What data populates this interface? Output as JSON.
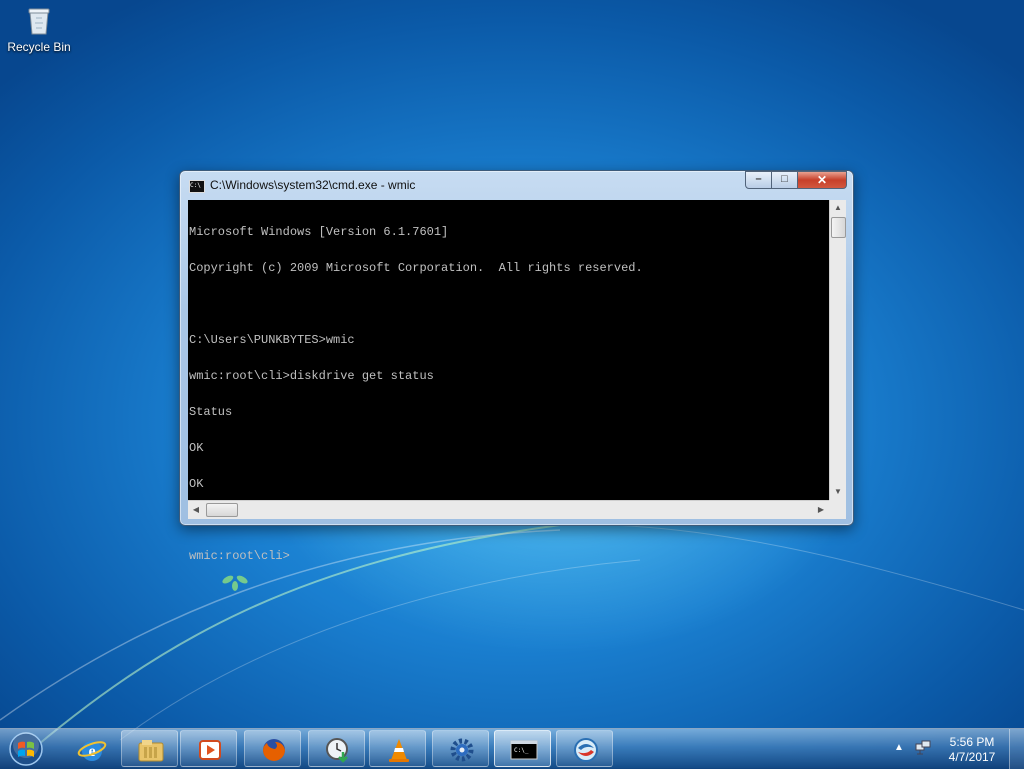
{
  "desktop": {
    "icons": [
      {
        "label": "Recycle Bin",
        "icon": "recycle-bin-icon"
      }
    ]
  },
  "window": {
    "title": "C:\\Windows\\system32\\cmd.exe - wmic",
    "controls": {
      "minimize": "–",
      "maximize": "□",
      "close": "✕"
    },
    "console_lines": [
      "Microsoft Windows [Version 6.1.7601]",
      "Copyright (c) 2009 Microsoft Corporation.  All rights reserved.",
      "",
      "C:\\Users\\PUNKBYTES>wmic",
      "wmic:root\\cli>diskdrive get status",
      "Status",
      "OK",
      "OK",
      "",
      "wmic:root\\cli>"
    ]
  },
  "taskbar": {
    "start_icon": "windows-start-orb-icon",
    "pinned": [
      {
        "name": "internet-explorer",
        "icon": "internet-explorer-icon"
      },
      {
        "name": "file-explorer",
        "icon": "folder-library-icon"
      },
      {
        "name": "media-player",
        "icon": "media-player-icon"
      },
      {
        "name": "firefox",
        "icon": "firefox-icon"
      },
      {
        "name": "download-utility",
        "icon": "clock-download-icon"
      },
      {
        "name": "vlc",
        "icon": "vlc-cone-icon"
      },
      {
        "name": "settings-tool",
        "icon": "gear-icon"
      },
      {
        "name": "cmd",
        "icon": "command-prompt-icon"
      },
      {
        "name": "app-circle",
        "icon": "blue-sphere-icon"
      }
    ],
    "clock_time": "5:56 PM",
    "clock_date": "4/7/2017"
  }
}
